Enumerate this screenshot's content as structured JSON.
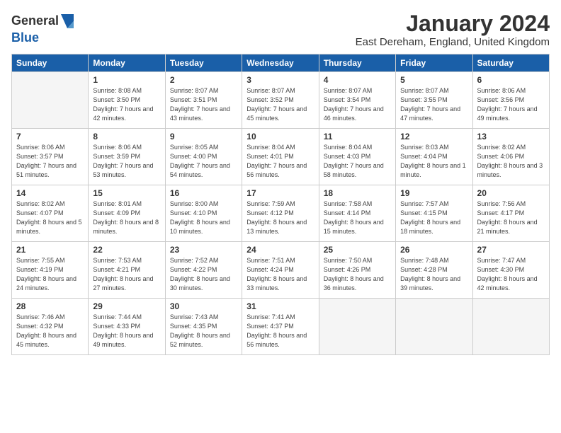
{
  "logo": {
    "general": "General",
    "blue": "Blue"
  },
  "title": {
    "month": "January 2024",
    "location": "East Dereham, England, United Kingdom"
  },
  "weekdays": [
    "Sunday",
    "Monday",
    "Tuesday",
    "Wednesday",
    "Thursday",
    "Friday",
    "Saturday"
  ],
  "weeks": [
    [
      {
        "day": "",
        "sunrise": "",
        "sunset": "",
        "daylight": "",
        "empty": true
      },
      {
        "day": "1",
        "sunrise": "Sunrise: 8:08 AM",
        "sunset": "Sunset: 3:50 PM",
        "daylight": "Daylight: 7 hours and 42 minutes."
      },
      {
        "day": "2",
        "sunrise": "Sunrise: 8:07 AM",
        "sunset": "Sunset: 3:51 PM",
        "daylight": "Daylight: 7 hours and 43 minutes."
      },
      {
        "day": "3",
        "sunrise": "Sunrise: 8:07 AM",
        "sunset": "Sunset: 3:52 PM",
        "daylight": "Daylight: 7 hours and 45 minutes."
      },
      {
        "day": "4",
        "sunrise": "Sunrise: 8:07 AM",
        "sunset": "Sunset: 3:54 PM",
        "daylight": "Daylight: 7 hours and 46 minutes."
      },
      {
        "day": "5",
        "sunrise": "Sunrise: 8:07 AM",
        "sunset": "Sunset: 3:55 PM",
        "daylight": "Daylight: 7 hours and 47 minutes."
      },
      {
        "day": "6",
        "sunrise": "Sunrise: 8:06 AM",
        "sunset": "Sunset: 3:56 PM",
        "daylight": "Daylight: 7 hours and 49 minutes."
      }
    ],
    [
      {
        "day": "7",
        "sunrise": "Sunrise: 8:06 AM",
        "sunset": "Sunset: 3:57 PM",
        "daylight": "Daylight: 7 hours and 51 minutes."
      },
      {
        "day": "8",
        "sunrise": "Sunrise: 8:06 AM",
        "sunset": "Sunset: 3:59 PM",
        "daylight": "Daylight: 7 hours and 53 minutes."
      },
      {
        "day": "9",
        "sunrise": "Sunrise: 8:05 AM",
        "sunset": "Sunset: 4:00 PM",
        "daylight": "Daylight: 7 hours and 54 minutes."
      },
      {
        "day": "10",
        "sunrise": "Sunrise: 8:04 AM",
        "sunset": "Sunset: 4:01 PM",
        "daylight": "Daylight: 7 hours and 56 minutes."
      },
      {
        "day": "11",
        "sunrise": "Sunrise: 8:04 AM",
        "sunset": "Sunset: 4:03 PM",
        "daylight": "Daylight: 7 hours and 58 minutes."
      },
      {
        "day": "12",
        "sunrise": "Sunrise: 8:03 AM",
        "sunset": "Sunset: 4:04 PM",
        "daylight": "Daylight: 8 hours and 1 minute."
      },
      {
        "day": "13",
        "sunrise": "Sunrise: 8:02 AM",
        "sunset": "Sunset: 4:06 PM",
        "daylight": "Daylight: 8 hours and 3 minutes."
      }
    ],
    [
      {
        "day": "14",
        "sunrise": "Sunrise: 8:02 AM",
        "sunset": "Sunset: 4:07 PM",
        "daylight": "Daylight: 8 hours and 5 minutes."
      },
      {
        "day": "15",
        "sunrise": "Sunrise: 8:01 AM",
        "sunset": "Sunset: 4:09 PM",
        "daylight": "Daylight: 8 hours and 8 minutes."
      },
      {
        "day": "16",
        "sunrise": "Sunrise: 8:00 AM",
        "sunset": "Sunset: 4:10 PM",
        "daylight": "Daylight: 8 hours and 10 minutes."
      },
      {
        "day": "17",
        "sunrise": "Sunrise: 7:59 AM",
        "sunset": "Sunset: 4:12 PM",
        "daylight": "Daylight: 8 hours and 13 minutes."
      },
      {
        "day": "18",
        "sunrise": "Sunrise: 7:58 AM",
        "sunset": "Sunset: 4:14 PM",
        "daylight": "Daylight: 8 hours and 15 minutes."
      },
      {
        "day": "19",
        "sunrise": "Sunrise: 7:57 AM",
        "sunset": "Sunset: 4:15 PM",
        "daylight": "Daylight: 8 hours and 18 minutes."
      },
      {
        "day": "20",
        "sunrise": "Sunrise: 7:56 AM",
        "sunset": "Sunset: 4:17 PM",
        "daylight": "Daylight: 8 hours and 21 minutes."
      }
    ],
    [
      {
        "day": "21",
        "sunrise": "Sunrise: 7:55 AM",
        "sunset": "Sunset: 4:19 PM",
        "daylight": "Daylight: 8 hours and 24 minutes."
      },
      {
        "day": "22",
        "sunrise": "Sunrise: 7:53 AM",
        "sunset": "Sunset: 4:21 PM",
        "daylight": "Daylight: 8 hours and 27 minutes."
      },
      {
        "day": "23",
        "sunrise": "Sunrise: 7:52 AM",
        "sunset": "Sunset: 4:22 PM",
        "daylight": "Daylight: 8 hours and 30 minutes."
      },
      {
        "day": "24",
        "sunrise": "Sunrise: 7:51 AM",
        "sunset": "Sunset: 4:24 PM",
        "daylight": "Daylight: 8 hours and 33 minutes."
      },
      {
        "day": "25",
        "sunrise": "Sunrise: 7:50 AM",
        "sunset": "Sunset: 4:26 PM",
        "daylight": "Daylight: 8 hours and 36 minutes."
      },
      {
        "day": "26",
        "sunrise": "Sunrise: 7:48 AM",
        "sunset": "Sunset: 4:28 PM",
        "daylight": "Daylight: 8 hours and 39 minutes."
      },
      {
        "day": "27",
        "sunrise": "Sunrise: 7:47 AM",
        "sunset": "Sunset: 4:30 PM",
        "daylight": "Daylight: 8 hours and 42 minutes."
      }
    ],
    [
      {
        "day": "28",
        "sunrise": "Sunrise: 7:46 AM",
        "sunset": "Sunset: 4:32 PM",
        "daylight": "Daylight: 8 hours and 45 minutes."
      },
      {
        "day": "29",
        "sunrise": "Sunrise: 7:44 AM",
        "sunset": "Sunset: 4:33 PM",
        "daylight": "Daylight: 8 hours and 49 minutes."
      },
      {
        "day": "30",
        "sunrise": "Sunrise: 7:43 AM",
        "sunset": "Sunset: 4:35 PM",
        "daylight": "Daylight: 8 hours and 52 minutes."
      },
      {
        "day": "31",
        "sunrise": "Sunrise: 7:41 AM",
        "sunset": "Sunset: 4:37 PM",
        "daylight": "Daylight: 8 hours and 56 minutes."
      },
      {
        "day": "",
        "sunrise": "",
        "sunset": "",
        "daylight": "",
        "empty": true
      },
      {
        "day": "",
        "sunrise": "",
        "sunset": "",
        "daylight": "",
        "empty": true
      },
      {
        "day": "",
        "sunrise": "",
        "sunset": "",
        "daylight": "",
        "empty": true
      }
    ]
  ]
}
